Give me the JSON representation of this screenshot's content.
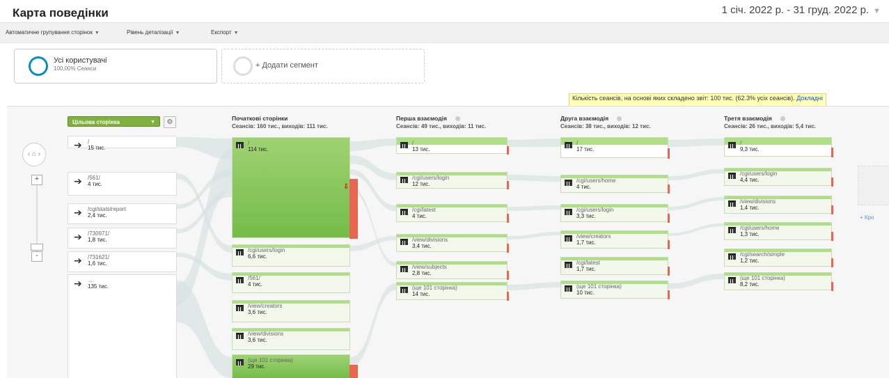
{
  "header": {
    "title": "Карта поведінки",
    "date_range": "1 січ. 2022 р. - 31 груд. 2022 р."
  },
  "toolbar": [
    {
      "label": "Автоматичне групування сторінок"
    },
    {
      "label": "Рівень деталізації"
    },
    {
      "label": "Експорт"
    }
  ],
  "segments": {
    "active": {
      "name": "Усі користувачі",
      "share": "100,00% Сеанси"
    },
    "add_label": "+ Додати сегмент"
  },
  "notice": {
    "text": "Кількість сеансів, на основі яких складено звіт: 100 тис. (62.3% усіх сеансів).",
    "link": "Докладні"
  },
  "dimension": {
    "label": "Цільова сторінка"
  },
  "sources": [
    {
      "label": "/",
      "value": "15 тис."
    },
    {
      "label": "/561/",
      "value": "4 тис."
    },
    {
      "label": "/cgi/stats/report",
      "value": "2,4 тис."
    },
    {
      "label": "/730971/",
      "value": "1,8 тис."
    },
    {
      "label": "/731621/",
      "value": "1,6 тис."
    },
    {
      "label": "...",
      "value": "135 тис."
    }
  ],
  "columns": [
    {
      "title": "Початкові сторінки",
      "stats": "Сеансів: 160 тис., виходів: 111 тис.",
      "nodes": [
        {
          "label": "/",
          "value": "114 тис.",
          "dropoff": 0.59
        },
        {
          "label": "/cgi/users/login",
          "value": "6,6 тис.",
          "dropoff": 0
        },
        {
          "label": "/561/",
          "value": "4 тис.",
          "dropoff": 0
        },
        {
          "label": "/view/creators",
          "value": "3,6 тис.",
          "dropoff": 0
        },
        {
          "label": "/view/divisions",
          "value": "3,6 тис.",
          "dropoff": 0
        },
        {
          "label": "(ще 101 сторінка)",
          "value": "29 тис.",
          "dropoff": 0.6
        }
      ]
    },
    {
      "title": "Перша взаємодія",
      "stats": "Сеансів: 49 тис., виходів: 11 тис.",
      "nodes": [
        {
          "label": "/",
          "value": "13 тис."
        },
        {
          "label": "/cgi/users/login",
          "value": "12 тис."
        },
        {
          "label": "/cgi/latest",
          "value": "4 тис."
        },
        {
          "label": "/view/divisions",
          "value": "3,4 тис."
        },
        {
          "label": "/view/subjects",
          "value": "2,8 тис."
        },
        {
          "label": "(ще 101 сторінка)",
          "value": "14 тис."
        }
      ]
    },
    {
      "title": "Друга взаємодія",
      "stats": "Сеансів: 38 тис., виходів: 12 тис.",
      "nodes": [
        {
          "label": "/",
          "value": "17 тис."
        },
        {
          "label": "/cgi/users/home",
          "value": "4 тис."
        },
        {
          "label": "/cgi/users/login",
          "value": "3,3 тис."
        },
        {
          "label": "/view/creators",
          "value": "1,7 тис."
        },
        {
          "label": "/cgi/latest",
          "value": "1,7 тис."
        },
        {
          "label": "(ще 101 сторінка)",
          "value": "10 тис."
        }
      ]
    },
    {
      "title": "Третя взаємодія",
      "stats": "Сеансів: 26 тис., виходів: 5,4 тис.",
      "nodes": [
        {
          "label": "/",
          "value": "9,3 тис."
        },
        {
          "label": "/cgi/users/login",
          "value": "4,4 тис."
        },
        {
          "label": "/view/divisions",
          "value": "1,4 тис."
        },
        {
          "label": "/cgi/users/home",
          "value": "1,3 тис."
        },
        {
          "label": "/cgi/search/simple",
          "value": "1,2 тис."
        },
        {
          "label": "(ще 101 сторінка)",
          "value": "8,2 тис."
        }
      ]
    }
  ],
  "add_step_label": "+ Кро",
  "colors": {
    "node_green": "#7fc651",
    "dropoff_red": "#e8664f",
    "segment_ring": "#058dc7",
    "dimension": "#7fb23d"
  }
}
